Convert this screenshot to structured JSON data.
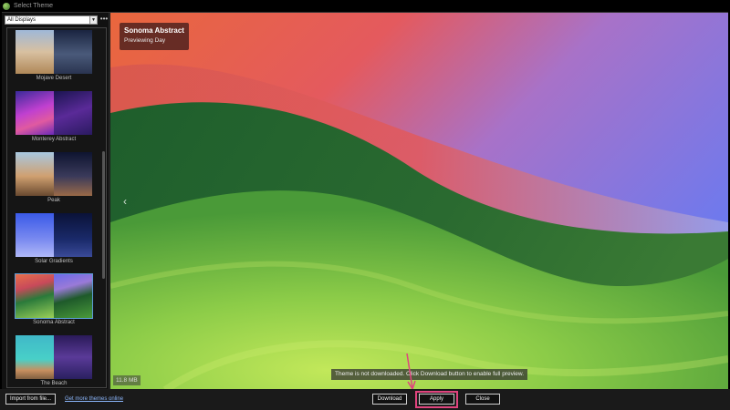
{
  "window": {
    "title": "Select Theme"
  },
  "sidebar": {
    "display_select": "All Displays",
    "more_label": "•••",
    "themes": [
      {
        "label": "Mojave Desert",
        "colors": [
          "#c8a878",
          "#3a4a6a"
        ]
      },
      {
        "label": "Monterey Abstract",
        "colors": [
          "#a23cc8",
          "#3a2a78"
        ]
      },
      {
        "label": "Peak",
        "colors": [
          "#d8b890",
          "#1a2240"
        ]
      },
      {
        "label": "Solar Gradients",
        "colors": [
          "#4a6ae8",
          "#0e1c4a"
        ]
      },
      {
        "label": "Sonoma Abstract",
        "colors": [
          "#e8704a",
          "#3a8a3a"
        ]
      },
      {
        "label": "The Beach",
        "colors": [
          "#38c8d0",
          "#3a2a6a"
        ]
      }
    ]
  },
  "preview": {
    "title": "Sonoma Abstract",
    "subtitle": "Previewing Day",
    "prev_icon": "‹",
    "size": "11.8 MB",
    "notice": "Theme is not downloaded. Click Download button to enable full preview."
  },
  "footer": {
    "import_label": "Import from file...",
    "more_themes_link": "Get more themes online",
    "download_label": "Download",
    "apply_label": "Apply",
    "close_label": "Close"
  },
  "colors": {
    "highlight": "#e0447e",
    "link": "#8ab4f8"
  }
}
